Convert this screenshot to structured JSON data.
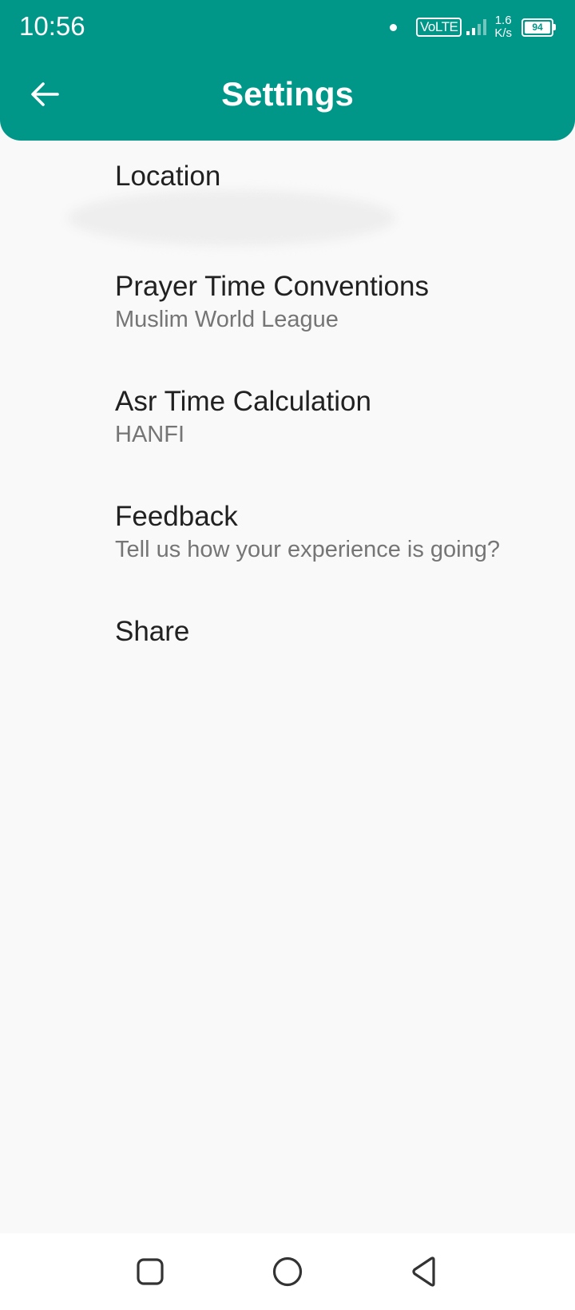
{
  "status_bar": {
    "time": "10:56",
    "network_label": "VoLTE",
    "speed_value": "1.6",
    "speed_unit": "K/s",
    "battery": "94"
  },
  "appbar": {
    "title": "Settings",
    "back_icon": "arrow-back-icon",
    "color": "#009688"
  },
  "settings": {
    "items": [
      {
        "title": "Location",
        "subtitle": ""
      },
      {
        "title": "Prayer Time Conventions",
        "subtitle": "Muslim World League"
      },
      {
        "title": "Asr Time Calculation",
        "subtitle": "HANFI"
      },
      {
        "title": "Feedback",
        "subtitle": "Tell us how your experience is going?"
      },
      {
        "title": "Share",
        "subtitle": ""
      }
    ]
  },
  "navigation_bar": {
    "buttons": [
      "recent-apps-icon",
      "home-icon",
      "back-icon"
    ]
  }
}
